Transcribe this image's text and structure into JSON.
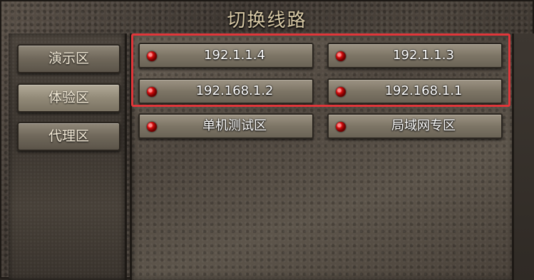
{
  "window": {
    "title": "切换线路"
  },
  "sidebar": {
    "items": [
      {
        "label": "演示区"
      },
      {
        "label": "体验区"
      },
      {
        "label": "代理区"
      }
    ]
  },
  "servers": {
    "items": [
      {
        "label": "192.1.1.4"
      },
      {
        "label": "192.1.1.3"
      },
      {
        "label": "192.168.1.2"
      },
      {
        "label": "192.168.1.1"
      },
      {
        "label": "单机测试区"
      },
      {
        "label": "局域网专区"
      }
    ]
  },
  "colors": {
    "highlight": "#e0363a",
    "status_dot": "#d10c0c"
  }
}
